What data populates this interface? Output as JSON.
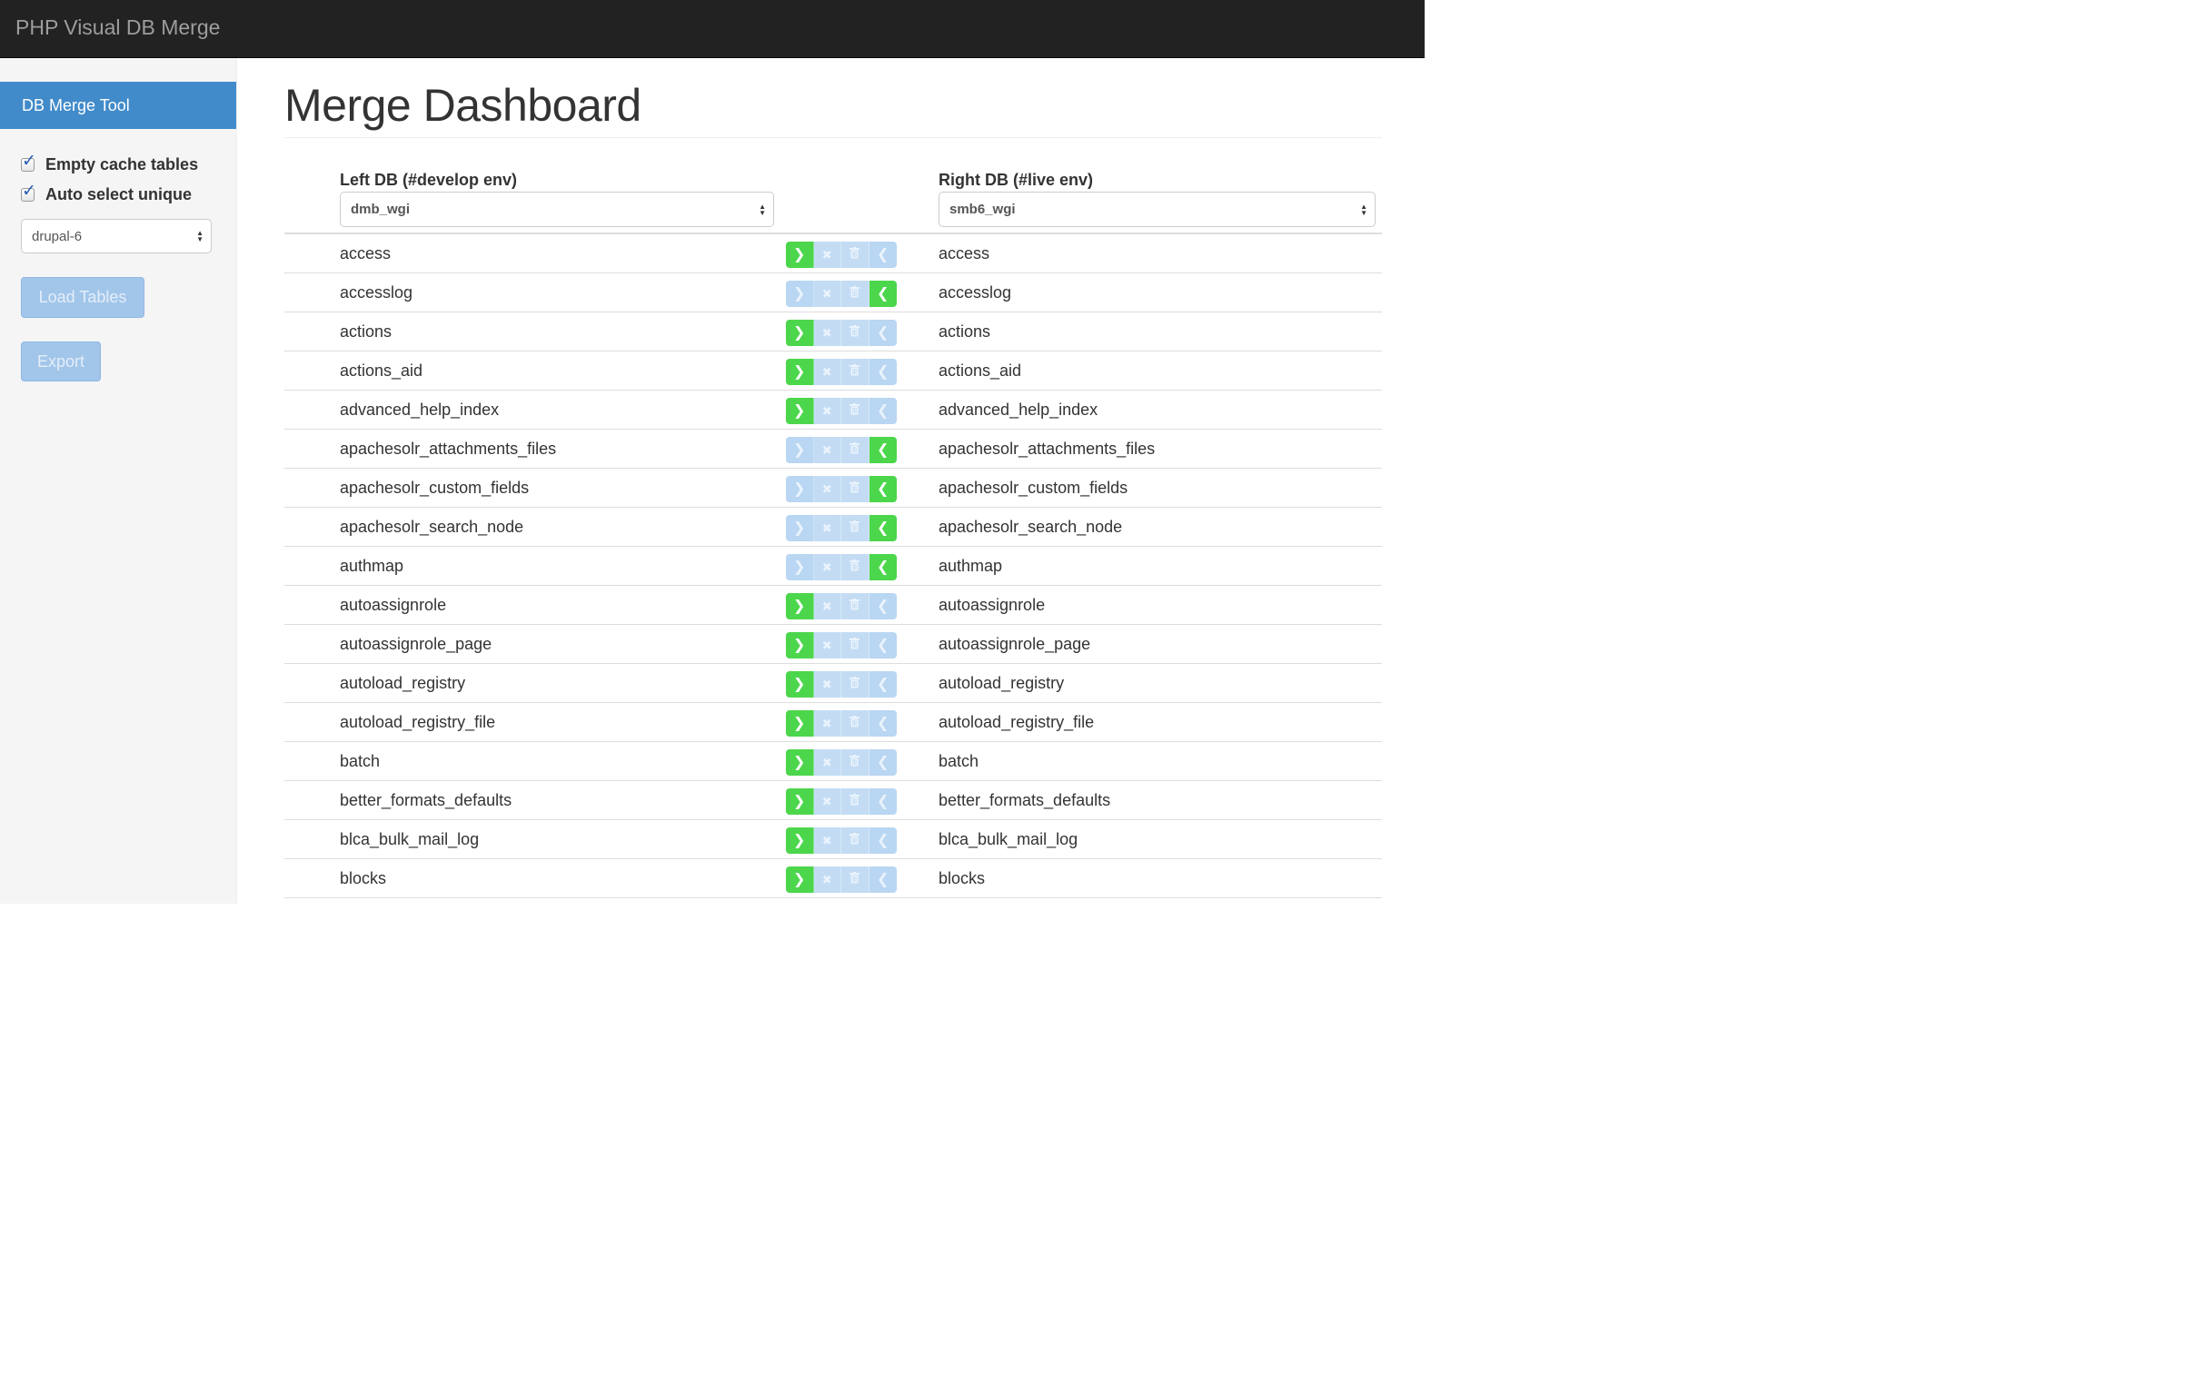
{
  "app": {
    "brand": "PHP Visual DB Merge"
  },
  "sidebar": {
    "active_item": "DB Merge Tool",
    "checkboxes": [
      {
        "label": "Empty cache tables",
        "checked": true
      },
      {
        "label": "Auto select unique",
        "checked": true
      }
    ],
    "profile_select": "drupal-6",
    "load_button": "Load Tables",
    "export_button": "Export"
  },
  "main": {
    "title": "Merge Dashboard",
    "left_db": {
      "label": "Left DB (#develop env)",
      "value": "dmb_wgi"
    },
    "right_db": {
      "label": "Right DB (#live env)",
      "value": "smb6_wgi"
    }
  },
  "icons": {
    "copy_right": "chevron-right-icon",
    "skip": "x-icon",
    "delete": "trash-icon",
    "copy_left": "chevron-left-icon"
  },
  "colors": {
    "navbar": "#222222",
    "active": "#428bca",
    "green": "#4cd64c",
    "disabled_blue": "#b9d6f2"
  },
  "rows": [
    {
      "left": "access",
      "right": "access",
      "direction": "right"
    },
    {
      "left": "accesslog",
      "right": "accesslog",
      "direction": "left"
    },
    {
      "left": "actions",
      "right": "actions",
      "direction": "right"
    },
    {
      "left": "actions_aid",
      "right": "actions_aid",
      "direction": "right"
    },
    {
      "left": "advanced_help_index",
      "right": "advanced_help_index",
      "direction": "right"
    },
    {
      "left": "apachesolr_attachments_files",
      "right": "apachesolr_attachments_files",
      "direction": "left"
    },
    {
      "left": "apachesolr_custom_fields",
      "right": "apachesolr_custom_fields",
      "direction": "left"
    },
    {
      "left": "apachesolr_search_node",
      "right": "apachesolr_search_node",
      "direction": "left"
    },
    {
      "left": "authmap",
      "right": "authmap",
      "direction": "left"
    },
    {
      "left": "autoassignrole",
      "right": "autoassignrole",
      "direction": "right"
    },
    {
      "left": "autoassignrole_page",
      "right": "autoassignrole_page",
      "direction": "right"
    },
    {
      "left": "autoload_registry",
      "right": "autoload_registry",
      "direction": "right"
    },
    {
      "left": "autoload_registry_file",
      "right": "autoload_registry_file",
      "direction": "right"
    },
    {
      "left": "batch",
      "right": "batch",
      "direction": "right"
    },
    {
      "left": "better_formats_defaults",
      "right": "better_formats_defaults",
      "direction": "right"
    },
    {
      "left": "blca_bulk_mail_log",
      "right": "blca_bulk_mail_log",
      "direction": "right"
    },
    {
      "left": "blocks",
      "right": "blocks",
      "direction": "right"
    }
  ]
}
